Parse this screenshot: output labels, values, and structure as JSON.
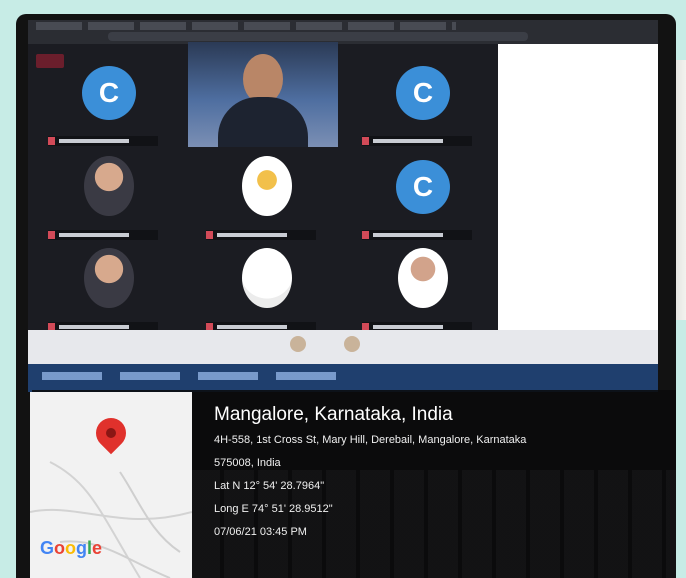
{
  "meeting": {
    "participant_initial": "C"
  },
  "location": {
    "title": "Mangalore, Karnataka, India",
    "address_line1": "4H-558, 1st Cross St, Mary Hill, Derebail, Mangalore, Karnataka",
    "address_line2": "575008, India",
    "lat": "Lat N 12° 54' 28.7964\"",
    "long": "Long E 74° 51' 28.9512\"",
    "datetime": "07/06/21 03:45 PM"
  },
  "map": {
    "logo": "Google",
    "pin_icon": "map-pin-icon",
    "pin_color": "#e0312c"
  },
  "colors": {
    "avatar_blue": "#3b8fd8",
    "frame_mint": "#c7ece6",
    "taskbar": "#1f3f6e"
  }
}
